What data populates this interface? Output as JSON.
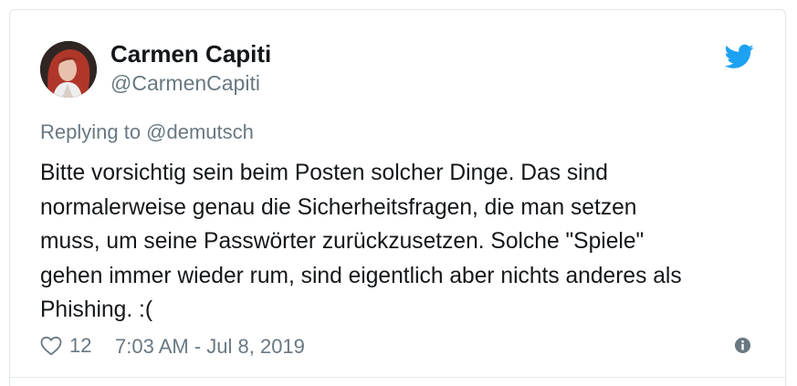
{
  "author": {
    "display_name": "Carmen Capiti",
    "handle": "@CarmenCapiti",
    "avatar_icon": "profile-photo"
  },
  "reply": {
    "text": "Replying to @demutsch"
  },
  "tweet": {
    "lines": [
      "Bitte vorsichtig sein beim Posten solcher Dinge. Das sind",
      "normalerweise genau die Sicherheitsfragen, die man setzen",
      "muss, um seine Passwörter zurückzusetzen. Solche \"Spiele\"",
      "gehen immer wieder rum, sind eigentlich aber nichts anderes als",
      "Phishing. :("
    ]
  },
  "footer": {
    "like_count": "12",
    "timestamp": "7:03 AM - Jul 8, 2019"
  },
  "icons": {
    "brand": "twitter-bird-icon",
    "like": "heart-icon",
    "info": "info-icon"
  },
  "colors": {
    "twitter_blue": "#1da1f2",
    "text_primary": "#14171a",
    "text_secondary": "#697882",
    "border": "#dfe3e8"
  }
}
